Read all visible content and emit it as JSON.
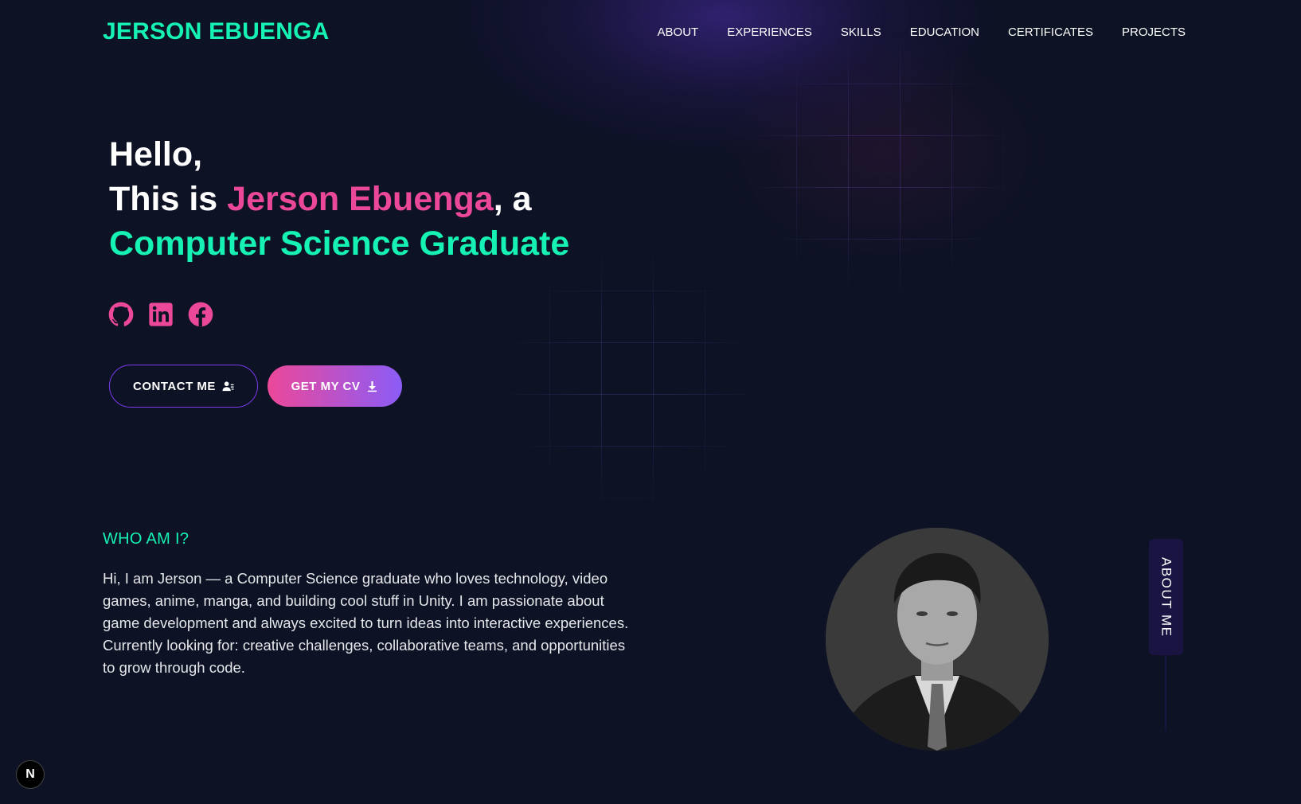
{
  "navbar": {
    "brand": "JERSON EBUENGA",
    "links": [
      "ABOUT",
      "EXPERIENCES",
      "SKILLS",
      "EDUCATION",
      "CERTIFICATES",
      "PROJECTS"
    ]
  },
  "hero": {
    "line1": "Hello,",
    "line2_prefix": "This is ",
    "name": "Jerson Ebuenga",
    "line2_suffix": ", a",
    "role": "Computer Science Graduate"
  },
  "socials": [
    {
      "name": "github-icon"
    },
    {
      "name": "linkedin-icon"
    },
    {
      "name": "facebook-icon"
    }
  ],
  "buttons": {
    "contact_label": "CONTACT ME",
    "contact_icon": "user-contact-icon",
    "cv_label": "GET MY CV",
    "cv_icon": "download-icon"
  },
  "about": {
    "title": "WHO AM I?",
    "text": "Hi, I am Jerson — a Computer Science graduate who loves technology, video games, anime, manga, and building cool stuff in Unity. I am passionate about game development and always excited to turn ideas into interactive experiences. Currently looking for: creative challenges, collaborative teams, and opportunities to grow through code.",
    "tab_label": "ABOUT ME",
    "photo_icon": "profile-photo"
  },
  "badge": {
    "label": "N"
  },
  "colors": {
    "background": "#0d1224",
    "accent_green": "#16f2b3",
    "accent_pink": "#ec4899",
    "accent_purple": "#8b5cf6",
    "tab_bg": "#1a1443"
  }
}
